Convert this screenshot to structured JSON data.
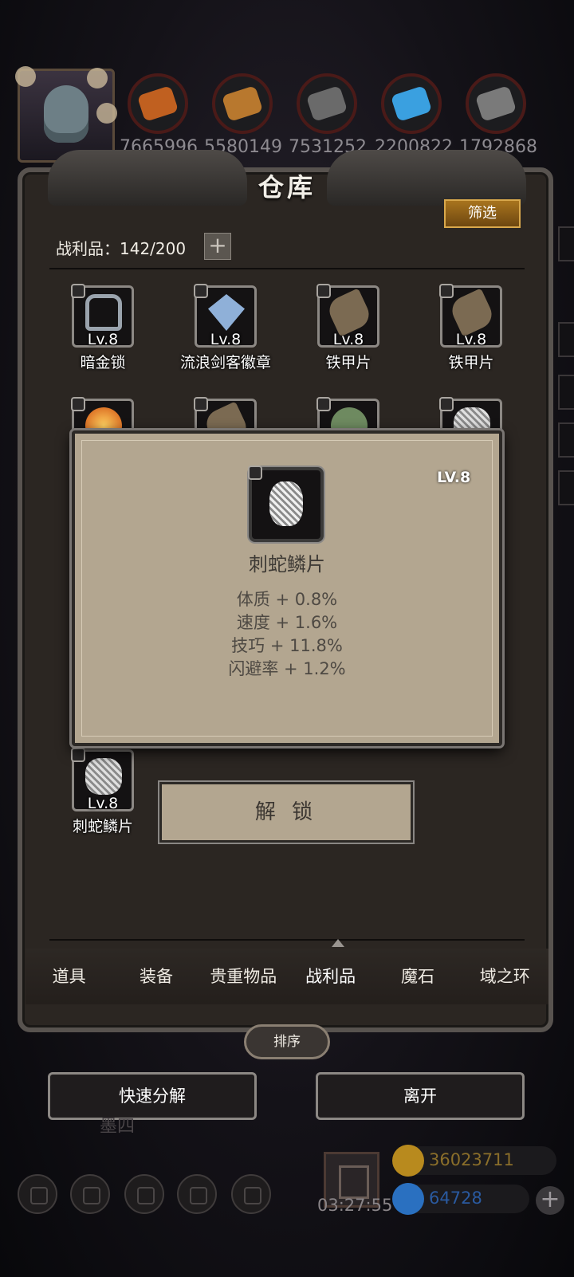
{
  "resources": {
    "values": [
      "7665996",
      "5580149",
      "7531252",
      "2200822",
      "1792868"
    ],
    "colors": [
      "#c06020",
      "#b8782e",
      "#6a6a6a",
      "#3aa0e0",
      "#7a7a7a"
    ]
  },
  "panel": {
    "title": "仓库",
    "filter_label": "筛选",
    "loot_count": "战利品：142/200",
    "plus_label": "+"
  },
  "grid_items": [
    {
      "name": "暗金锁",
      "level": "Lv.8",
      "icon": "padlock-icon",
      "color": "#9aa3ad"
    },
    {
      "name": "流浪剑客徽章",
      "level": "Lv.8",
      "icon": "badge-icon",
      "color": "#8fb0d8"
    },
    {
      "name": "铁甲片",
      "level": "Lv.8",
      "icon": "armor-plate-icon",
      "color": "#7b6a52"
    },
    {
      "name": "铁甲片",
      "level": "Lv.8",
      "icon": "armor-plate-icon",
      "color": "#7b6a52"
    },
    {
      "name": "刺蛇鳞片",
      "level": "Lv.8",
      "icon": "scale-icon",
      "color": "#d0d0d0"
    }
  ],
  "popup": {
    "level": "LV.8",
    "item_name": "刺蛇鳞片",
    "stats": [
      "体质 + 0.8%",
      "速度 + 1.6%",
      "技巧 + 11.8%",
      "闪避率 + 1.2%"
    ]
  },
  "unlock_label": "解 锁",
  "tabs": [
    "道具",
    "装备",
    "贵重物品",
    "战利品",
    "魔石",
    "域之环"
  ],
  "active_tab": "战利品",
  "sort_label": "排序",
  "quick_decompose_label": "快速分解",
  "leave_label": "离开",
  "bottom": {
    "partial_label": "墨四",
    "timer": "03:27:55",
    "gold": "36023711",
    "gems": "64728",
    "gold_color": "#b88a1e",
    "gem_color": "#2a70c0",
    "plus_label": "+"
  }
}
